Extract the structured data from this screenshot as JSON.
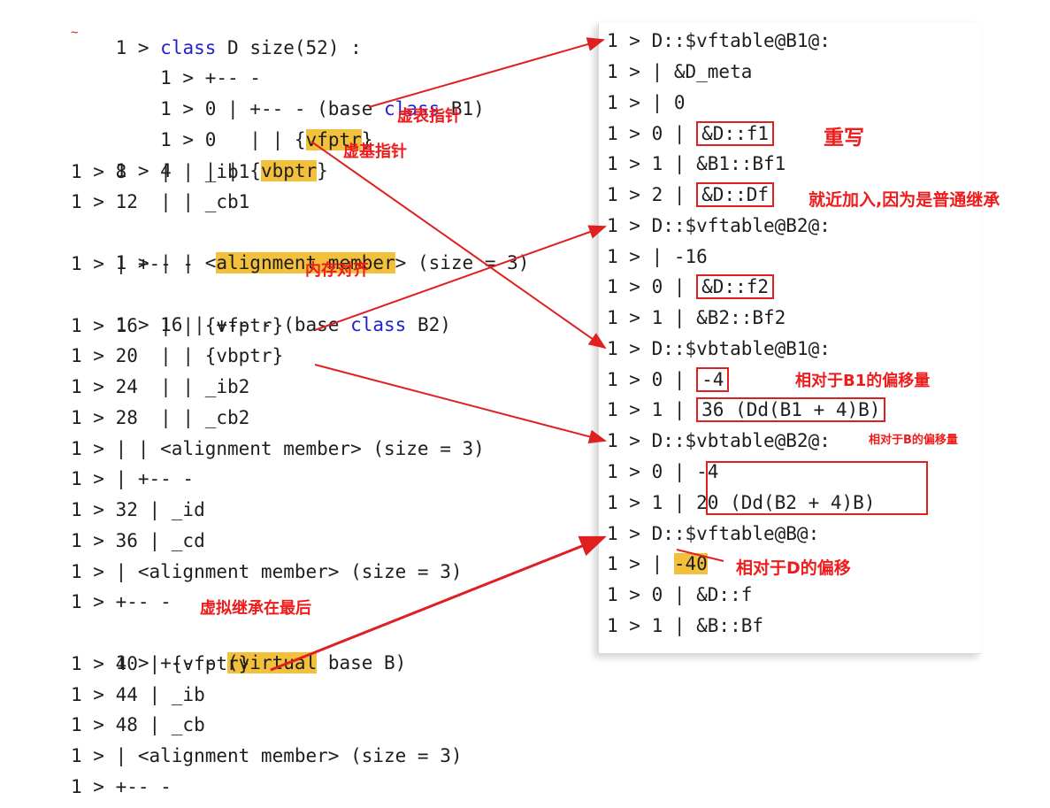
{
  "left": {
    "lines": [
      {
        "num": "1 >",
        "pre": " ",
        "kw": "class",
        "post": " D size(52) :"
      },
      {
        "num": "    1 >",
        "text": " +-- -"
      },
      {
        "num": "    1 >",
        "text": " 0 | +-- - (base ",
        "kw": "class",
        "post": " B1)"
      },
      {
        "num": "    1 >",
        "text": " 0   | | {",
        "hl": "vfptr",
        "post": "}"
      },
      {
        "text": "1 > 4   | | {",
        "hl": "vbptr",
        "post": "}"
      },
      {
        "text": "1 > 8   | | _ib1"
      },
      {
        "text": "1 > 12  | | _cb1"
      },
      {
        "text": "1 > | | <",
        "hl": "alignment member",
        "post": "> (size = 3)"
      },
      {
        "text": "1 > | +-- -"
      },
      {
        "text": "1 > 16 | +-- - (base ",
        "kw": "class",
        "post": " B2)"
      },
      {
        "text": "1 > 16  | | {vfptr}"
      },
      {
        "text": "1 > 20  | | {vbptr}"
      },
      {
        "text": "1 > 24  | | _ib2"
      },
      {
        "text": "1 > 28  | | _cb2"
      },
      {
        "text": "1 > | | <alignment member> (size = 3)"
      },
      {
        "text": "1 > | +-- -"
      },
      {
        "text": "1 > 32 | _id"
      },
      {
        "text": "1 > 36 | _cd"
      },
      {
        "text": "1 > | <alignment member> (size = 3)"
      },
      {
        "text": "1 > +-- -"
      },
      {
        "text": "1 > +-- - ",
        "hl": "(virtual",
        "post": " base B)"
      },
      {
        "text": "1 > 40 | {vfptr}"
      },
      {
        "text": "1 > 44 | _ib"
      },
      {
        "text": "1 > 48 | _cb"
      },
      {
        "text": "1 > | <alignment member> (size = 3)"
      },
      {
        "text": "1 > +-- -"
      }
    ]
  },
  "right": {
    "lines": [
      {
        "text": "1 > D::$vftable@B1@:"
      },
      {
        "text": "1 > | &D_meta"
      },
      {
        "text": "1 > | 0"
      },
      {
        "pre": "1 > 0 | ",
        "box": "&D::f1"
      },
      {
        "text": "1 > 1 | &B1::Bf1"
      },
      {
        "pre": "1 > 2 | ",
        "box": "&D::Df"
      },
      {
        "text": "1 > D::$vftable@B2@:"
      },
      {
        "text": "1 > | -16"
      },
      {
        "pre": "1 > 0 | ",
        "box": "&D::f2"
      },
      {
        "text": "1 > 1 | &B2::Bf2"
      },
      {
        "text": "1 > D::$vbtable@B1@:"
      },
      {
        "pre": "1 > 0 | ",
        "box": "-4"
      },
      {
        "pre": "1 > 1 | ",
        "box": "36 (Dd(B1 + 4)B)"
      },
      {
        "text": "1 > D::$vbtable@B2@:"
      },
      {
        "text": "1 > 0 | -4"
      },
      {
        "text": "1 > 1 | 20 (Dd(B2 + 4)B)"
      },
      {
        "text": "1 > D::$vftable@B@:"
      },
      {
        "pre": "1 > | ",
        "hl": "-40"
      },
      {
        "text": "1 > 0 | &D::f"
      },
      {
        "text": "1 > 1 | &B::Bf"
      }
    ]
  },
  "annotations": {
    "vfptr": "虚表指针",
    "vbptr": "虚基指针",
    "align": "内存对齐",
    "virtual_last": "虚拟继承在最后",
    "override": "重写",
    "append": "就近加入,因为是普通继承",
    "offset_b1": "相对于B1的偏移量",
    "offset_b": "相对于B的偏移量",
    "offset_d": "相对于D的偏移"
  },
  "colors": {
    "annotation": "#ee1c1c",
    "highlight": "#f2c03a",
    "keyword": "#2222cc"
  }
}
